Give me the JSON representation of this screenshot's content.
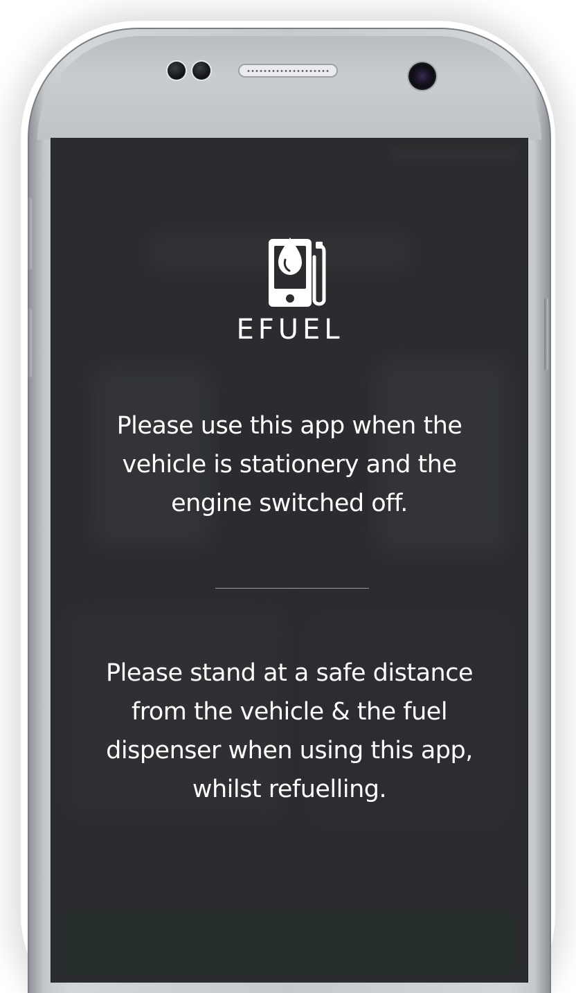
{
  "app": {
    "logo_text": "EFUEL",
    "logo_icon": "fuel-phone-icon"
  },
  "messages": {
    "stationary_notice": "Please use this app when the vehicle is stationery and the engine switched off.",
    "distance_notice": "Please stand at a safe distance from the vehicle & the fuel dispenser when using this app, whilst refuelling."
  },
  "colors": {
    "screen_background": "#2b2c2f",
    "text": "#ffffff",
    "divider": "#9a9ca0"
  }
}
